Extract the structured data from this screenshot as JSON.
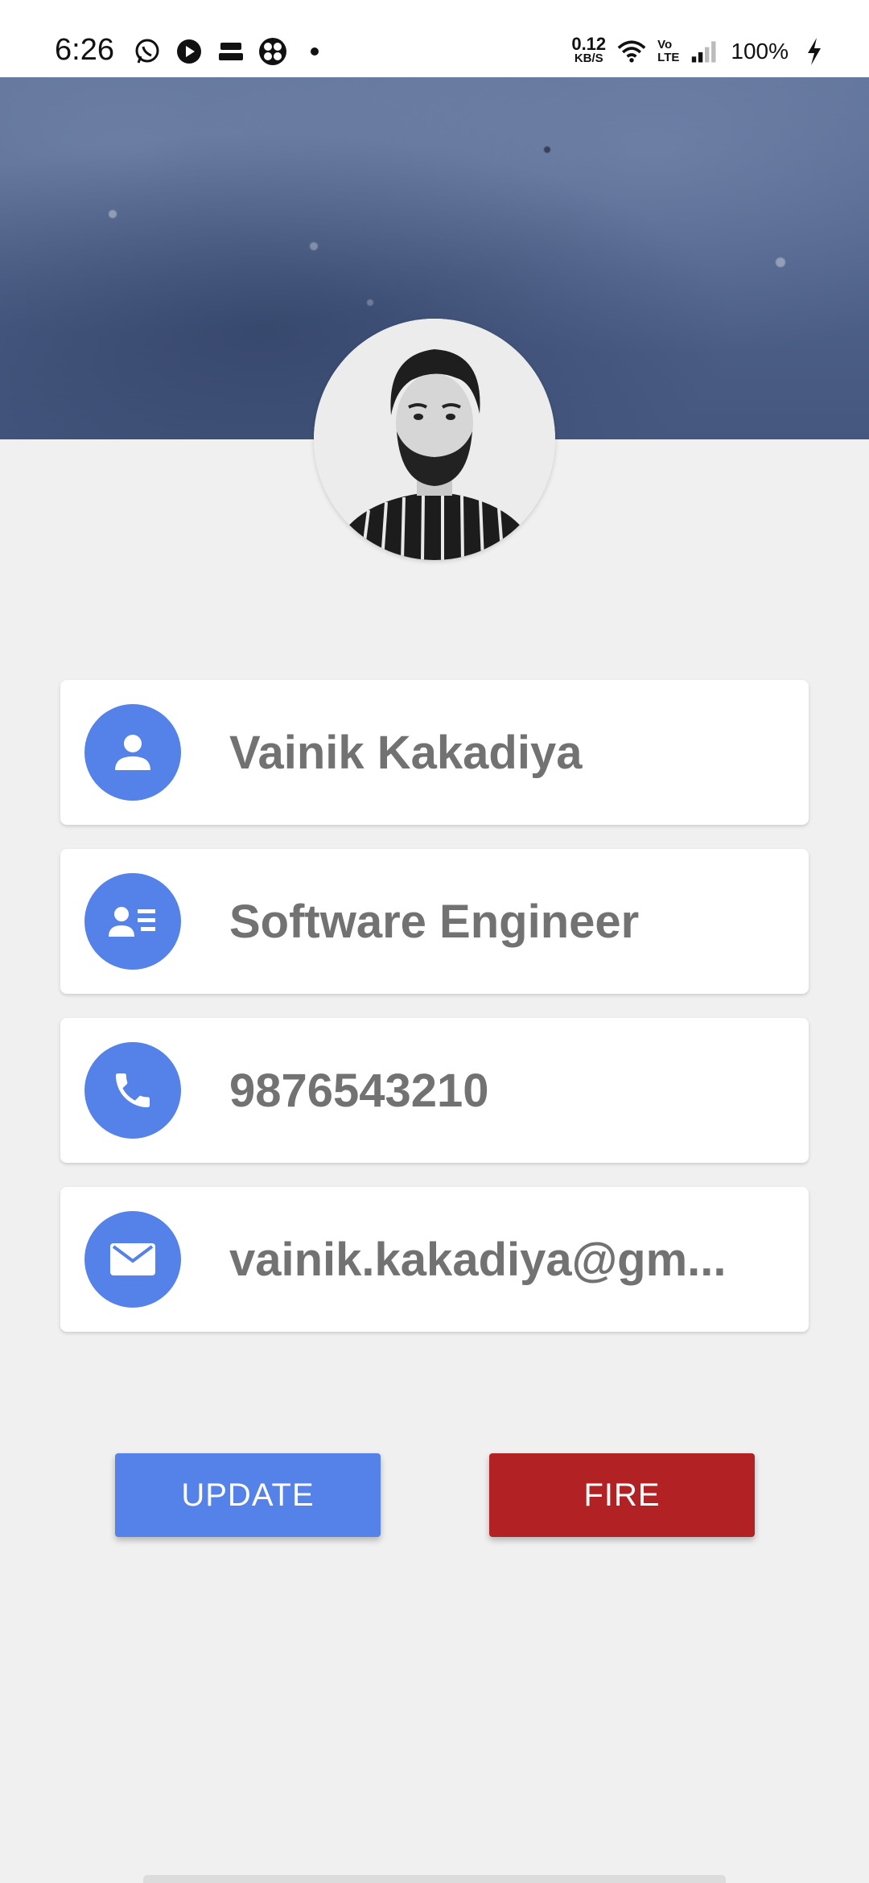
{
  "status_bar": {
    "time": "6:26",
    "net_speed_value": "0.12",
    "net_speed_unit": "KB/S",
    "volte_top": "Vo",
    "volte_bottom": "LTE",
    "battery": "100%"
  },
  "profile": {
    "name": "Vainik Kakadiya",
    "designation": "Software Engineer",
    "phone": "9876543210",
    "email": "vainik.kakadiya@gm..."
  },
  "actions": {
    "update_label": "UPDATE",
    "fire_label": "FIRE"
  },
  "colors": {
    "accent": "#5582e8",
    "danger": "#b22123",
    "text": "#727272",
    "background": "#f0f0f0"
  },
  "icons": {
    "name": "person-icon",
    "designation": "contact-card-icon",
    "phone": "phone-icon",
    "email": "mail-icon"
  }
}
